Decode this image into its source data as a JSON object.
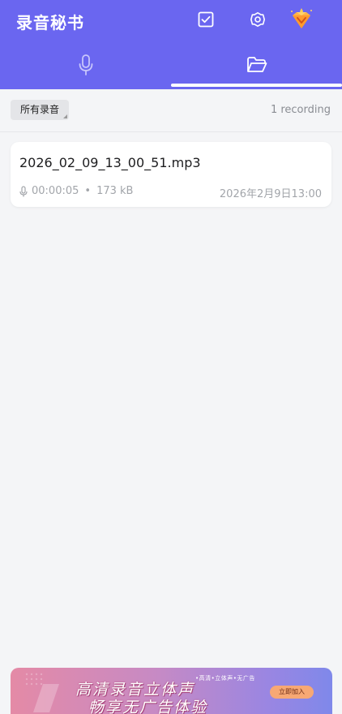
{
  "app": {
    "title": "录音秘书"
  },
  "toolbar": {
    "check_icon": "checkbox-icon",
    "settings_icon": "gear-icon",
    "vip_icon": "diamond-icon"
  },
  "tabs": [
    {
      "icon": "microphone-icon",
      "selected": false
    },
    {
      "icon": "folder-icon",
      "selected": true
    }
  ],
  "filter": {
    "label": "所有录音",
    "count": "1 recording"
  },
  "recordings": [
    {
      "file_name": "2026_02_09_13_00_51.mp3",
      "duration": "00:00:05",
      "separator": "•",
      "size": "173 kB",
      "date": "2026年2月9日13:00"
    }
  ],
  "banner": {
    "line1": "高清录音立体声",
    "line2": "畅享无广告体验",
    "small": "•高清•立体声•无广告",
    "button": "立即加入"
  },
  "colors": {
    "header": "#6a66f0",
    "background": "#f4f5f7",
    "card": "#ffffff",
    "muted_text": "#a2a5aa"
  }
}
